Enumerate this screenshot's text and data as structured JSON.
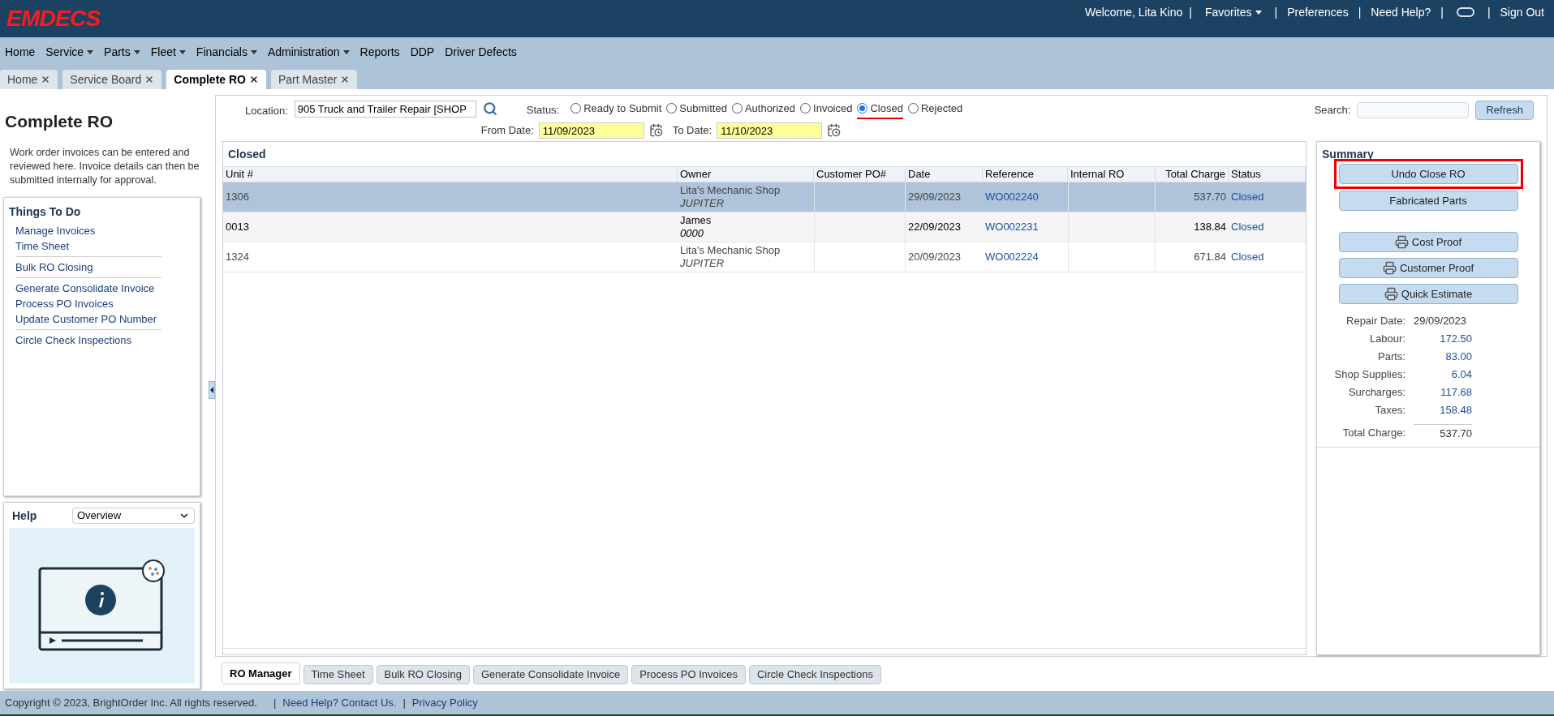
{
  "header": {
    "logo": "EMDECS",
    "separator": "|",
    "links": [
      {
        "kind": "text",
        "label": "Welcome, Lita Kino"
      },
      {
        "kind": "dropdown",
        "label": "Favorites"
      },
      {
        "kind": "link",
        "label": "Preferences"
      },
      {
        "kind": "link",
        "label": "Need Help?"
      },
      {
        "kind": "icon"
      },
      {
        "kind": "link",
        "label": "Sign Out"
      }
    ]
  },
  "menu": [
    {
      "label": "Home",
      "dropdown": false
    },
    {
      "label": "Service",
      "dropdown": true
    },
    {
      "label": "Parts",
      "dropdown": true
    },
    {
      "label": "Fleet",
      "dropdown": true
    },
    {
      "label": "Financials",
      "dropdown": true
    },
    {
      "label": "Administration",
      "dropdown": true
    },
    {
      "label": "Reports",
      "dropdown": false
    },
    {
      "label": "DDP",
      "dropdown": false
    },
    {
      "label": "Driver Defects",
      "dropdown": false
    }
  ],
  "tabs": [
    {
      "label": "Home",
      "selected": false
    },
    {
      "label": "Service Board",
      "selected": false
    },
    {
      "label": "Complete RO",
      "selected": true
    },
    {
      "label": "Part Master",
      "selected": false
    }
  ],
  "left_panel": {
    "title": "Complete RO",
    "description": "Work order invoices can be entered and reviewed here. Invoice details can then be submitted internally for approval.",
    "things_to_do": {
      "title": "Things To Do",
      "groups": [
        [
          "Manage Invoices",
          "Time Sheet"
        ],
        [
          "Bulk RO Closing"
        ],
        [
          "Generate Consolidate Invoice",
          "Process PO Invoices",
          "Update Customer PO Number"
        ],
        [
          "Circle Check Inspections"
        ]
      ]
    },
    "help": {
      "title": "Help",
      "topic": "Overview"
    }
  },
  "filters": {
    "location_label": "Location:",
    "location": "905 Truck and Trailer Repair [SHOP",
    "status_label": "Status:",
    "status_options": [
      {
        "label": "Ready to Submit",
        "selected": false,
        "underlined": false
      },
      {
        "label": "Submitted",
        "selected": false,
        "underlined": false
      },
      {
        "label": "Authorized",
        "selected": false,
        "underlined": false
      },
      {
        "label": "Invoiced",
        "selected": false,
        "underlined": false
      },
      {
        "label": "Closed",
        "selected": true,
        "underlined": true
      },
      {
        "label": "Rejected",
        "selected": false,
        "underlined": false
      }
    ],
    "from_label": "From Date:",
    "from_date": "11/09/2023",
    "to_label": "To Date:",
    "to_date": "11/10/2023",
    "search_label": "Search:",
    "refresh": "Refresh"
  },
  "table": {
    "title": "Closed",
    "columns": [
      "Unit #",
      "Owner",
      "Customer PO#",
      "Date",
      "Reference",
      "Internal RO",
      "Total Charge",
      "Status"
    ],
    "rows": [
      {
        "selected": true,
        "emphasized": false,
        "unit": "1306",
        "owner": "Lita's Mechanic Shop",
        "owner_sub": "JUPITER",
        "date": "29/09/2023",
        "reference": "WO002240",
        "total": "537.70",
        "status": "Closed"
      },
      {
        "selected": false,
        "emphasized": true,
        "unit": "0013",
        "owner": "James",
        "owner_sub": "0000",
        "date": "22/09/2023",
        "reference": "WO002231",
        "total": "138.84",
        "status": "Closed"
      },
      {
        "selected": false,
        "emphasized": false,
        "unit": "1324",
        "owner": "Lita's Mechanic Shop",
        "owner_sub": "JUPITER",
        "date": "20/09/2023",
        "reference": "WO002224",
        "total": "671.84",
        "status": "Closed"
      }
    ]
  },
  "summary": {
    "title": "Summary",
    "buttons": [
      {
        "kind": "action",
        "label": "Undo Close RO",
        "highlighted": true
      },
      {
        "kind": "action",
        "label": "Fabricated Parts",
        "highlighted": false
      },
      {
        "kind": "print",
        "label": "Cost Proof",
        "highlighted": false
      },
      {
        "kind": "print",
        "label": "Customer Proof",
        "highlighted": false
      },
      {
        "kind": "print",
        "label": "Quick Estimate",
        "highlighted": false
      }
    ],
    "fields": [
      {
        "kind": "date",
        "label": "Repair Date:",
        "value": "29/09/2023"
      },
      {
        "kind": "amount",
        "label": "Labour:",
        "value": "172.50"
      },
      {
        "kind": "amount",
        "label": "Parts:",
        "value": "83.00"
      },
      {
        "kind": "amount",
        "label": "Shop Supplies:",
        "value": "6.04"
      },
      {
        "kind": "amount",
        "label": "Surcharges:",
        "value": "117.68"
      },
      {
        "kind": "amount",
        "label": "Taxes:",
        "value": "158.48"
      },
      {
        "kind": "total",
        "label": "Total Charge:",
        "value": "537.70"
      }
    ]
  },
  "bottom_tabs": [
    {
      "label": "RO Manager",
      "selected": true
    },
    {
      "label": "Time Sheet",
      "selected": false
    },
    {
      "label": "Bulk RO Closing",
      "selected": false
    },
    {
      "label": "Generate Consolidate Invoice",
      "selected": false
    },
    {
      "label": "Process PO Invoices",
      "selected": false
    },
    {
      "label": "Circle Check Inspections",
      "selected": false
    }
  ],
  "footer": {
    "copyright": "Copyright © 2023, BrightOrder Inc. All rights reserved.",
    "separator": "|",
    "links": [
      "Need Help? Contact Us.",
      "Privacy Policy"
    ]
  }
}
